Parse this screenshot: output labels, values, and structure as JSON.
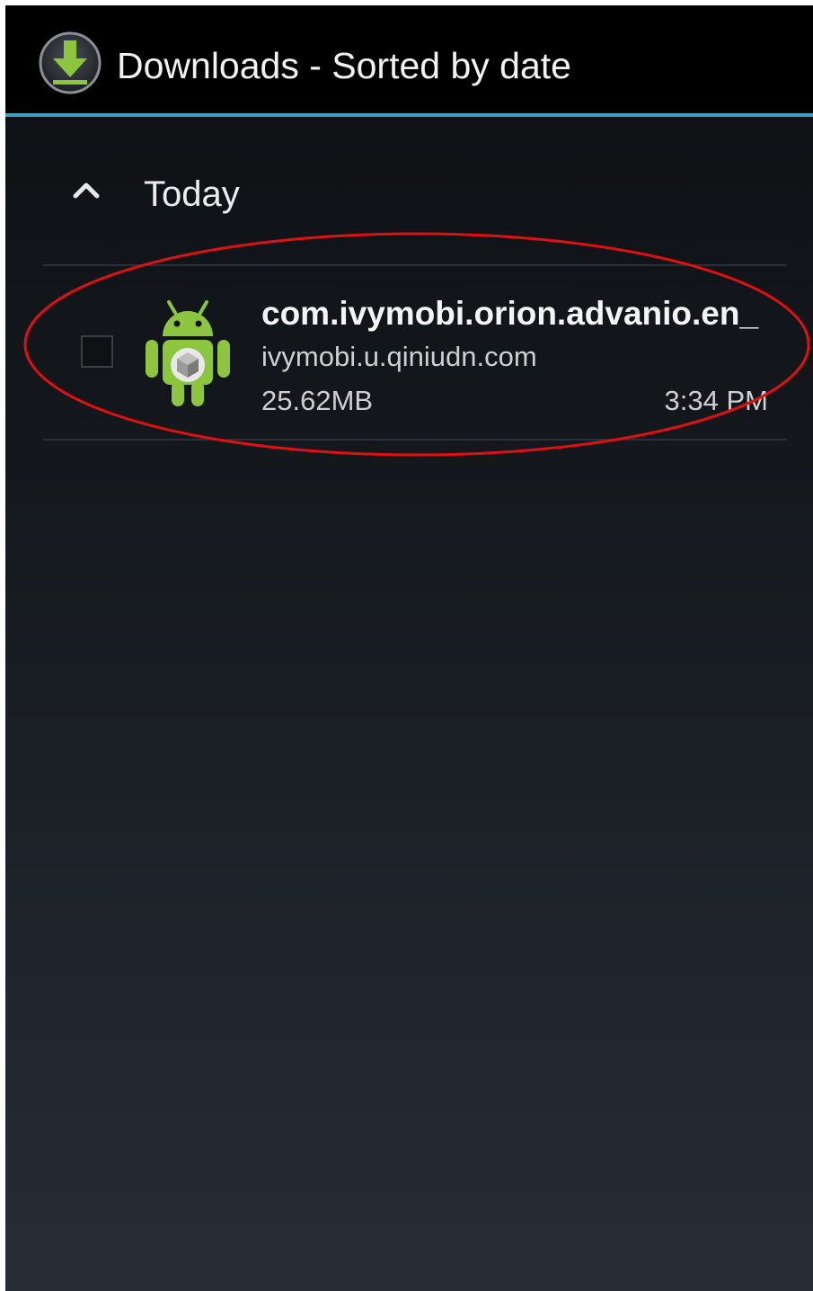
{
  "action_bar": {
    "title": "Downloads - Sorted by date",
    "icon": "download-arrow-icon",
    "accent_color": "#3f9fc3"
  },
  "groups": [
    {
      "label": "Today",
      "expanded": true,
      "items": [
        {
          "file_name": "com.ivymobi.orion.advanio.en_",
          "source": "ivymobi.u.qiniudn.com",
          "size": "25.62MB",
          "time": "3:34 PM",
          "checked": false,
          "icon": "android-apk-icon"
        }
      ]
    }
  ],
  "annotation": {
    "shape": "ellipse",
    "color": "#e01010"
  }
}
